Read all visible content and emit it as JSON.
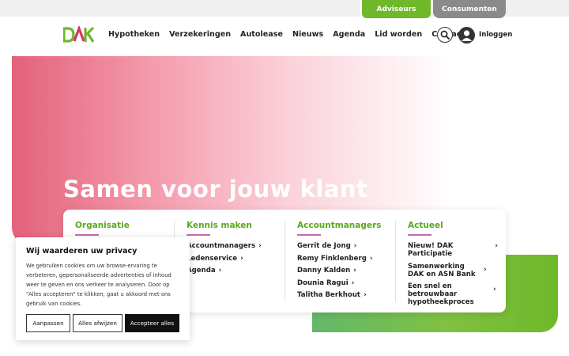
{
  "tabs": {
    "adviseurs": "Adviseurs",
    "consumenten": "Consumenten"
  },
  "logo": {
    "text": "DAK"
  },
  "nav": [
    {
      "label": "Hypotheken"
    },
    {
      "label": "Verzekeringen"
    },
    {
      "label": "Autolease"
    },
    {
      "label": "Nieuws"
    },
    {
      "label": "Agenda"
    },
    {
      "label": "Lid worden"
    },
    {
      "label": "Contact"
    }
  ],
  "header": {
    "login": "Inloggen",
    "search_icon": "search-icon",
    "user_icon": "user-icon"
  },
  "hero": {
    "title": "Samen voor jouw klant"
  },
  "menu": {
    "columns": [
      {
        "title": "Organisatie",
        "items": []
      },
      {
        "title": "Kennis maken",
        "items": [
          "Accountmanagers",
          "Ledenservice",
          "Agenda"
        ]
      },
      {
        "title": "Accountmanagers",
        "items": [
          "Gerrit de Jong",
          "Remy Finklenberg",
          "Danny Kalden",
          "Dounia Ragui",
          "Talitha Berkhout"
        ]
      },
      {
        "title": "Actueel",
        "items": [
          "Nieuw! DAK Participatie",
          "Samenwerking DAK en ASN Bank",
          "Een snel en betrouwbaar hypotheekproces"
        ]
      }
    ]
  },
  "cookie": {
    "title": "Wij waarderen uw privacy",
    "body": "We gebruiken cookies om uw browse-ervaring te verbeteren, gepersonaliseerde advertenties of inhoud weer te geven en ons verkeer te analyseren. Door op \"Alles accepteren\" te klikken, gaat u akkoord met ons gebruik van cookies.",
    "customize": "Aanpassen",
    "reject": "Alles afwijzen",
    "accept": "Accepteer alles"
  },
  "colors": {
    "brand_green": "#6fb82a",
    "brand_pink": "#e3627a",
    "accent_purple": "#c56ab0"
  }
}
